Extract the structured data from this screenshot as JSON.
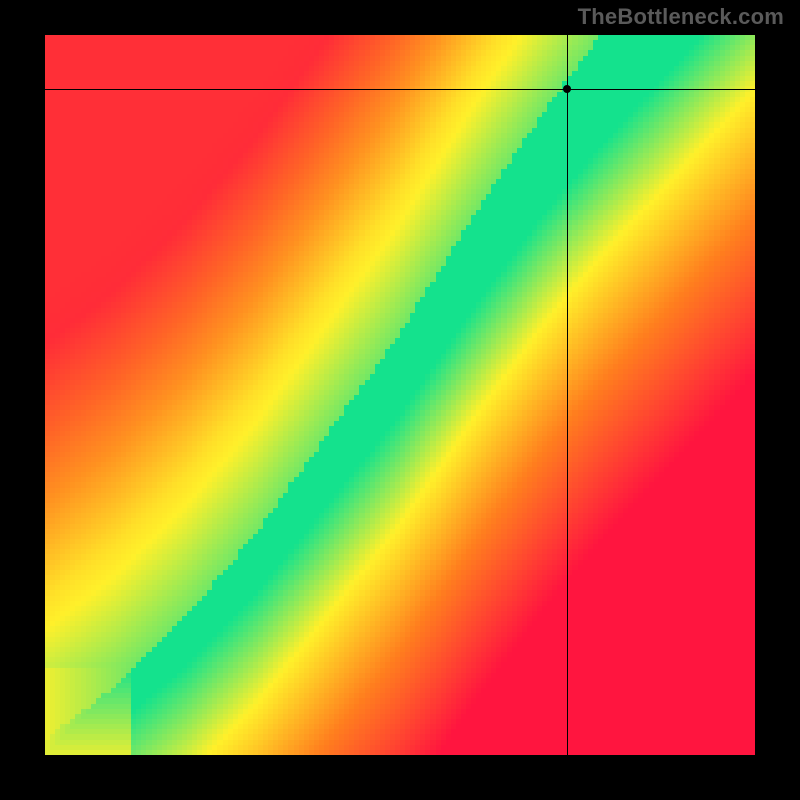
{
  "watermark": "TheBottleneck.com",
  "chart_data": {
    "type": "heatmap",
    "title": "",
    "xlabel": "",
    "ylabel": "",
    "xlim": [
      0,
      1
    ],
    "ylim": [
      0,
      1
    ],
    "grid": false,
    "crosshair": {
      "x": 0.735,
      "y": 0.925
    },
    "marker": {
      "x": 0.735,
      "y": 0.925
    },
    "optimal_path": {
      "description": "monotone ridge of best match (green) from origin toward upper-right, steeper than y=x",
      "points": [
        [
          0.0,
          0.0
        ],
        [
          0.1,
          0.07
        ],
        [
          0.2,
          0.16
        ],
        [
          0.3,
          0.27
        ],
        [
          0.4,
          0.4
        ],
        [
          0.5,
          0.53
        ],
        [
          0.6,
          0.68
        ],
        [
          0.7,
          0.82
        ],
        [
          0.78,
          0.92
        ],
        [
          0.85,
          1.0
        ]
      ],
      "band_half_width": 0.04
    },
    "legend": {
      "colorscale": [
        {
          "value": 0.0,
          "color": "#ff1a3c",
          "meaning": "severe mismatch"
        },
        {
          "value": 0.3,
          "color": "#ff7a1a",
          "meaning": "mismatch"
        },
        {
          "value": 0.6,
          "color": "#ffef2e",
          "meaning": "near match"
        },
        {
          "value": 1.0,
          "color": "#14e08a",
          "meaning": "optimal"
        }
      ]
    },
    "corner_hues": {
      "bottom_left": "#ff1a55",
      "top_left": "#ff1a3c",
      "top_right": "#fff23a",
      "bottom_right": "#ff1a3c"
    }
  },
  "colors": {
    "background": "#000000",
    "watermark": "#5a5a5a"
  }
}
